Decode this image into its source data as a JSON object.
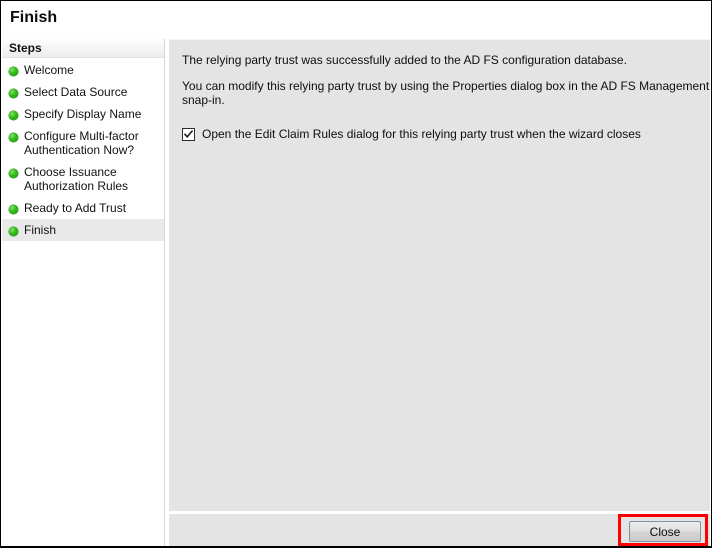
{
  "window": {
    "title": "Finish"
  },
  "sidebar": {
    "header": "Steps",
    "items": [
      {
        "label": "Welcome",
        "active": false
      },
      {
        "label": "Select Data Source",
        "active": false
      },
      {
        "label": "Specify Display Name",
        "active": false
      },
      {
        "label": "Configure Multi-factor\nAuthentication Now?",
        "active": false
      },
      {
        "label": "Choose Issuance\nAuthorization Rules",
        "active": false
      },
      {
        "label": "Ready to Add Trust",
        "active": false
      },
      {
        "label": "Finish",
        "active": true
      }
    ]
  },
  "content": {
    "paragraph1": "The relying party trust was successfully added to the AD FS configuration database.",
    "paragraph2": "You can modify this relying party trust by using the Properties dialog box in the AD FS Management snap-in.",
    "checkbox": {
      "label": "Open the Edit Claim Rules dialog for this relying party trust when the wizard closes",
      "checked": true
    }
  },
  "footer": {
    "close_label": "Close"
  },
  "annotation": {
    "color": "#fe0000",
    "target": "close-button"
  }
}
